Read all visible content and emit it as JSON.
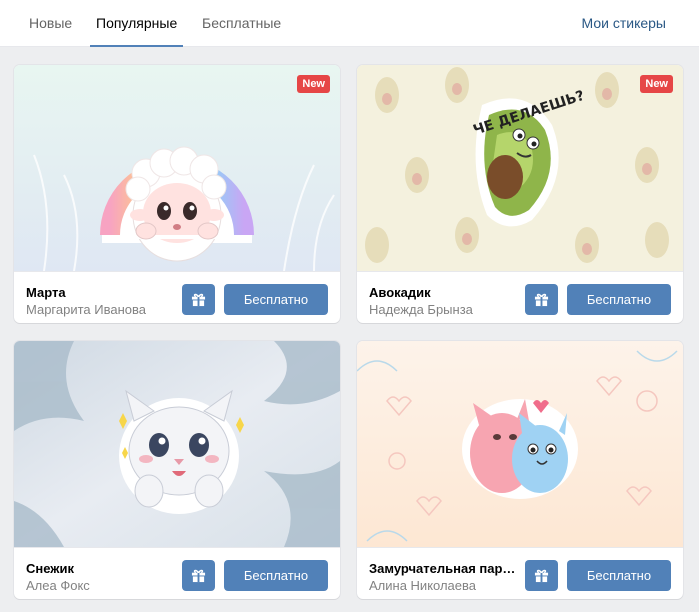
{
  "tabs": {
    "items": [
      {
        "label": "Новые"
      },
      {
        "label": "Популярные",
        "active": true
      },
      {
        "label": "Бесплатные"
      }
    ],
    "my_stickers": "Мои стикеры"
  },
  "cards": [
    {
      "title": "Марта",
      "author": "Маргарита Иванова",
      "badge": "New",
      "button": "Бесплатно",
      "sticker": "sheep-sticker-icon"
    },
    {
      "title": "Авокадик",
      "author": "Надежда Брынза",
      "badge": "New",
      "button": "Бесплатно",
      "sticker": "avocado-sticker-icon",
      "sticker_caption": "ЧЕ ДЕЛАЕШЬ?"
    },
    {
      "title": "Снежик",
      "author": "Алеа Фокс",
      "button": "Бесплатно",
      "sticker": "white-cat-sticker-icon"
    },
    {
      "title": "Замурчательная парочка",
      "author": "Алина Николаева",
      "button": "Бесплатно",
      "sticker": "cat-couple-sticker-icon"
    }
  ],
  "colors": {
    "accent": "#5181b8",
    "badge": "#e64646",
    "link": "#2a5885"
  }
}
